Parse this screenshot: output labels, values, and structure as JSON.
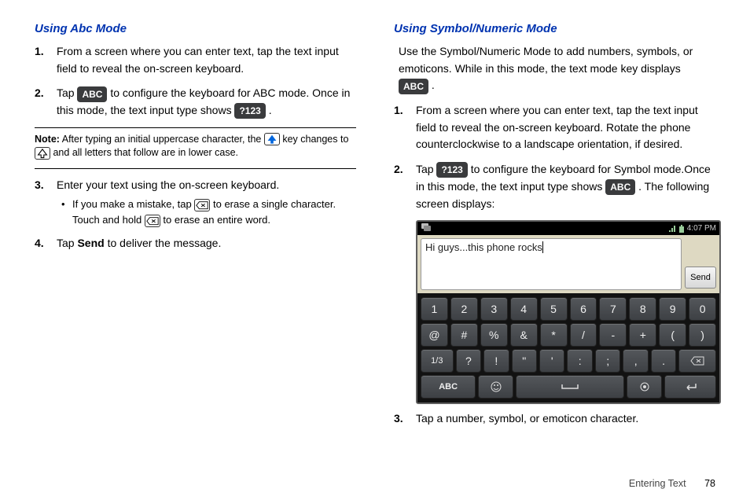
{
  "left": {
    "heading": "Using Abc Mode",
    "step1": "From a screen where you can enter text, tap the text input field to reveal the on-screen keyboard.",
    "step2a": "Tap ",
    "step2_key1": "ABC",
    "step2b": " to configure the keyboard for ABC mode. Once in this mode, the text input type shows ",
    "step2_key2": "?123",
    "step2c": ".",
    "note_label": "Note:",
    "note_a": " After typing an initial uppercase character, the ",
    "note_b": " key changes to ",
    "note_c": " and all letters that follow are in lower case.",
    "step3": "Enter your text using the on-screen keyboard.",
    "bullet_a": "If you make a mistake, tap ",
    "bullet_b": " to erase a single character. Touch and hold ",
    "bullet_c": " to erase an entire word.",
    "step4a": "Tap ",
    "step4_bold": "Send",
    "step4b": " to deliver the message."
  },
  "right": {
    "heading": "Using Symbol/Numeric Mode",
    "intro_a": "Use the Symbol/Numeric Mode to add numbers, symbols, or emoticons. While in this mode, the text mode key displays ",
    "intro_key": "ABC",
    "intro_b": ".",
    "step1": "From a screen where you can enter text, tap the text input field to reveal the on-screen keyboard. Rotate the phone counterclockwise to a landscape orientation, if desired.",
    "step2a": "Tap ",
    "step2_key1": "?123",
    "step2b": " to configure the keyboard for Symbol mode.Once in this mode, the text input type shows ",
    "step2_key2": "ABC",
    "step2c": ". The following screen displays:",
    "step3": "Tap a number, symbol, or emoticon character."
  },
  "phone": {
    "time": "4:07 PM",
    "msg": "Hi guys...this phone rocks",
    "send": "Send",
    "row1": [
      "1",
      "2",
      "3",
      "4",
      "5",
      "6",
      "7",
      "8",
      "9",
      "0"
    ],
    "row2": [
      "@",
      "#",
      "%",
      "&",
      "*",
      "/",
      "-",
      "+",
      "(",
      ")"
    ],
    "page": "1/3",
    "row3": [
      "?",
      "!",
      "\"",
      "'",
      ":",
      ";",
      ",",
      "."
    ],
    "abc": "ABC",
    "space": "⎵"
  },
  "footer": {
    "section": "Entering Text",
    "page": "78"
  }
}
